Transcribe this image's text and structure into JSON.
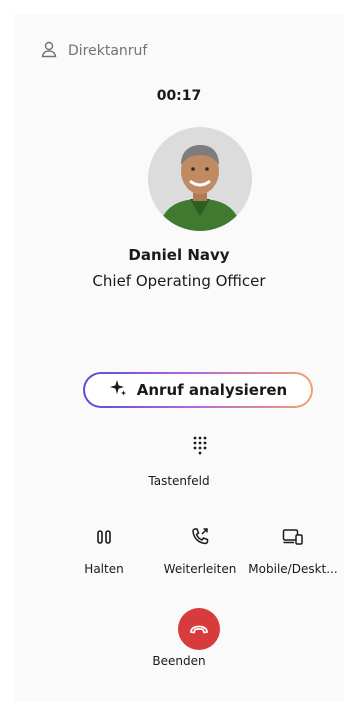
{
  "header": {
    "label": "Direktanruf",
    "icon": "person-icon"
  },
  "call": {
    "timer": "00:17"
  },
  "contact": {
    "name": "Daniel Navy",
    "title": "Chief Operating Officer"
  },
  "ai_button": {
    "label": "Anruf analysieren",
    "icon": "sparkle-icon"
  },
  "keypad": {
    "label": "Tastenfeld",
    "icon": "dialpad-icon"
  },
  "actions": [
    {
      "label": "Halten",
      "icon": "pause-icon"
    },
    {
      "label": "Weiterleiten",
      "icon": "transfer-phone-icon"
    },
    {
      "label": "Mobile/Deskt...",
      "icon": "devices-icon"
    }
  ],
  "end_call": {
    "label": "Beenden",
    "icon": "hang-up-icon",
    "color": "#d83b3b"
  }
}
